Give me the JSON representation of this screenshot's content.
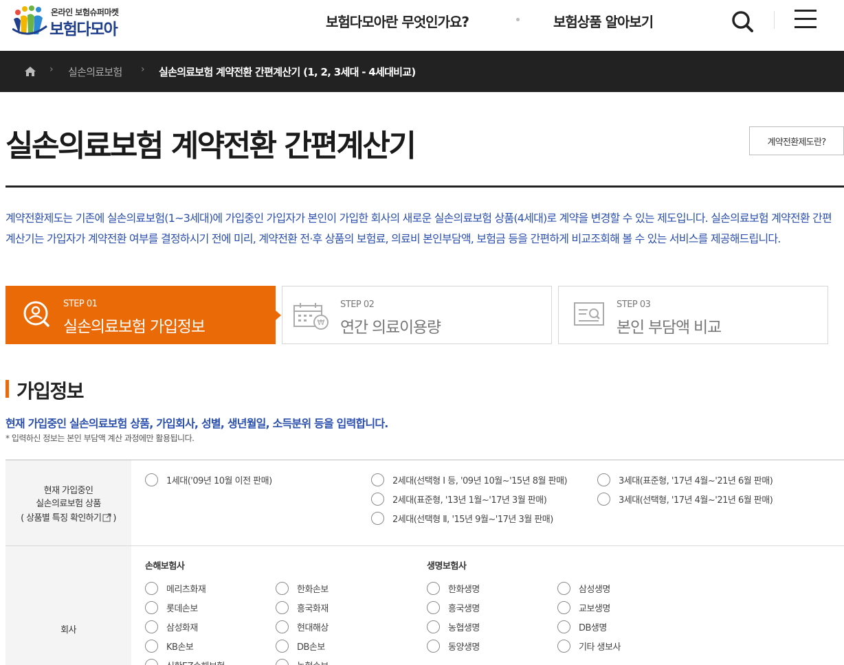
{
  "header": {
    "logo_sub": "온라인 보험슈퍼마켓",
    "logo_main": "보험다모아",
    "nav": [
      "보험다모아란 무엇인가요?",
      "보험상품 알아보기"
    ]
  },
  "breadcrumb": {
    "items": [
      "실손의료보험",
      "실손의료보험 계약전환 간편계산기 (1, 2, 3세대 - 4세대비교)"
    ]
  },
  "page": {
    "title": "실손의료보험 계약전환 간편계산기",
    "about_button": "계약전환제도란?",
    "intro": "계약전환제도는 기존에 실손의료보험(1~3세대)에 가입중인 가입자가 본인이 가입한 회사의 새로운 실손의료보험 상품(4세대)로 계약을 변경할 수 있는 제도입니다. 실손의료보험 계약전환 간편계산기는 가입자가 계약전환 여부를 결정하시기 전에 미리, 계약전환 전·후 상품의 보험료, 의료비 본인부담액, 보험금 등을 간편하게 비교조회해 볼 수 있는 서비스를 제공해드립니다."
  },
  "steps": [
    {
      "num": "STEP 01",
      "label": "실손의료보험 가입정보",
      "active": true,
      "icon": "user-search-icon"
    },
    {
      "num": "STEP 02",
      "label": "연간 의료이용량",
      "active": false,
      "icon": "calendar-money-icon"
    },
    {
      "num": "STEP 03",
      "label": "본인 부담액 비교",
      "active": false,
      "icon": "document-search-icon"
    }
  ],
  "section": {
    "title": "가입정보",
    "lead": "현재 가입중인 실손의료보험 상품, 가입회사, 성별, 생년월일, 소득분위 등을 입력합니다.",
    "note": "* 입력하신 정보는 본인 부담액 계산 과정에만 활용됩니다."
  },
  "product_row": {
    "label_line1": "현재 가입중인",
    "label_line2": "실손의료보험 상품",
    "label_link": "( 상품별 특징 확인하기",
    "label_link_end": ")",
    "options": [
      "1세대('09년 10월 이전 판매)",
      "2세대(선택형 Ⅰ 등, '09년 10월~'15년 8월 판매)",
      "2세대(표준형, '13년 1월~'17년 3월 판매)",
      "2세대(선택형 Ⅱ, '15년 9월~'17년 3월 판매)",
      "3세대(표준형, '17년 4월~'21년 6월 판매)",
      "3세대(선택형, '17년 4월~'21년 6월 판매)"
    ]
  },
  "company_row": {
    "label": "회사",
    "nonlife_title": "손해보험사",
    "nonlife": [
      "메리츠화재",
      "롯데손보",
      "삼성화재",
      "KB손보",
      "신한EZ손해보험",
      "한화손보",
      "흥국화재",
      "현대해상",
      "DB손보",
      "농협손보"
    ],
    "life_title": "생명보험사",
    "life": [
      "한화생명",
      "흥국생명",
      "농협생명",
      "동양생명",
      "삼성생명",
      "교보생명",
      "DB생명",
      "기타 생보사"
    ]
  },
  "colors": {
    "accent": "#ea6a07",
    "blue_text": "#2b4fae",
    "dark_bar": "#222222"
  }
}
